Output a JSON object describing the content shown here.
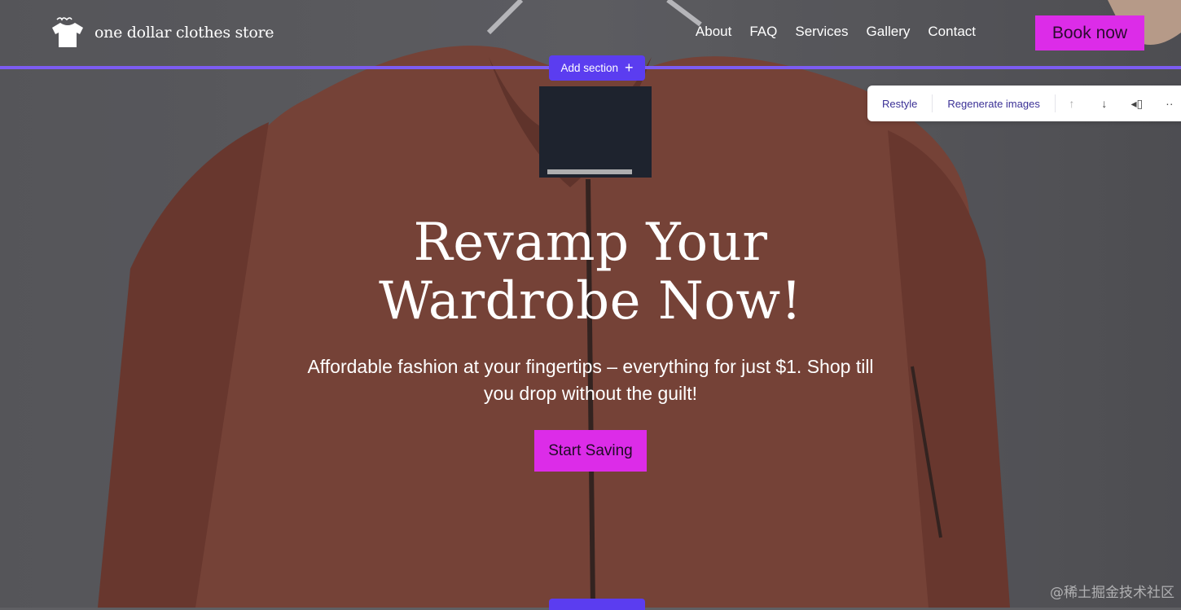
{
  "header": {
    "logo_text": "one dollar clothes store",
    "nav": [
      "About",
      "FAQ",
      "Services",
      "Gallery",
      "Contact"
    ],
    "book_label": "Book now"
  },
  "editor": {
    "add_section_label": "Add section",
    "toolbar": {
      "restyle": "Restyle",
      "regenerate": "Regenerate images"
    }
  },
  "hero": {
    "headline": "Revamp Your Wardrobe Now!",
    "subtext": "Affordable fashion at your fingertips – everything for just $1. Shop till you drop without the guilt!",
    "cta_label": "Start Saving"
  },
  "watermark": "@稀土掘金技术社区",
  "colors": {
    "accent": "#dc2ce8",
    "editor": "#5b3df0"
  }
}
